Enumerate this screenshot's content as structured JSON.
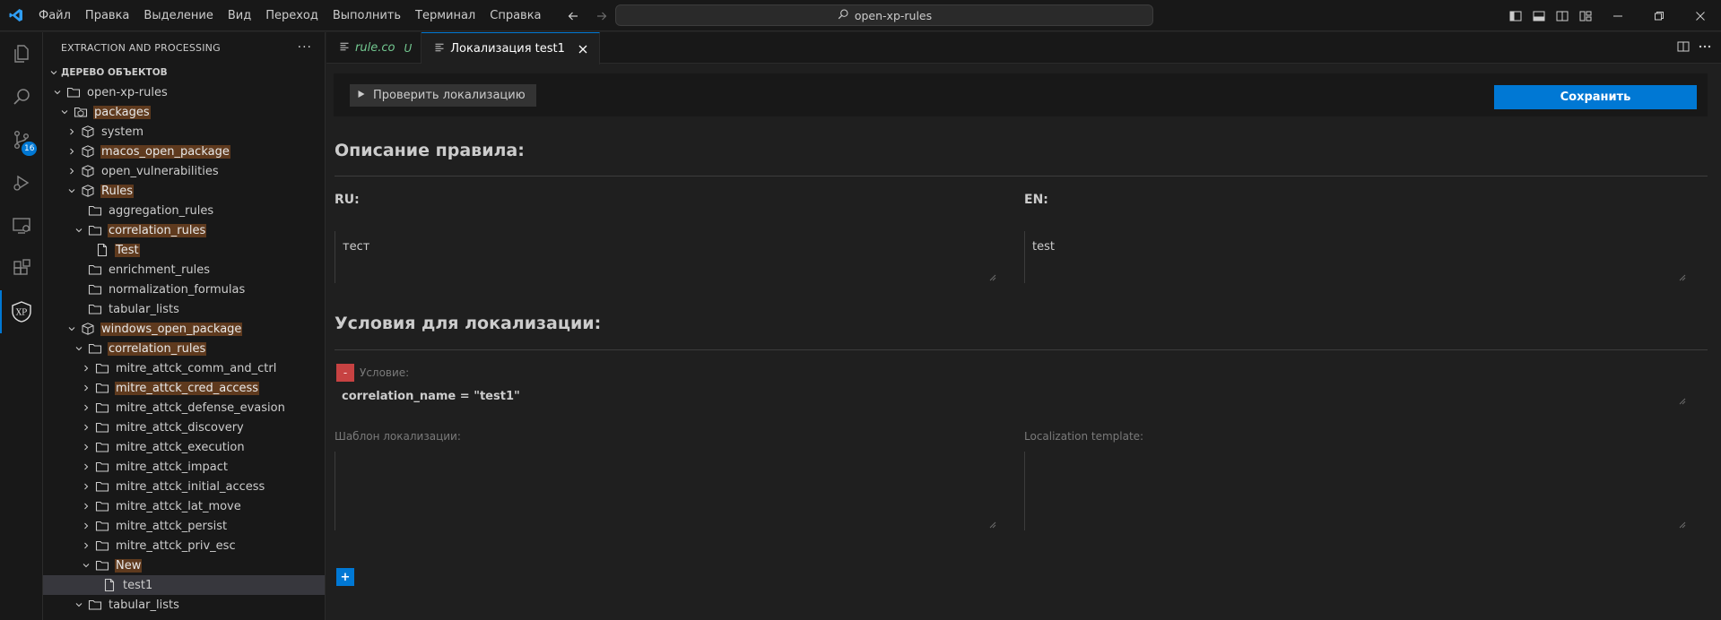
{
  "menu": [
    "Файл",
    "Правка",
    "Выделение",
    "Вид",
    "Переход",
    "Выполнить",
    "Терминал",
    "Справка"
  ],
  "search": {
    "text": "open-xp-rules"
  },
  "activity": {
    "scm_badge": "16",
    "xp_label": "XP"
  },
  "sidebar": {
    "title": "EXTRACTION AND PROCESSING",
    "more": "···",
    "section": "ДЕРЕВО ОБЪЕКТОВ",
    "tree": [
      {
        "label": "open-xp-rules",
        "depth": 0,
        "chevron": "down",
        "icon": "folder-icon",
        "hl": false
      },
      {
        "label": "packages",
        "depth": 1,
        "chevron": "down",
        "icon": "package-root-icon",
        "hl": true
      },
      {
        "label": "system",
        "depth": 2,
        "chevron": "right",
        "icon": "package-icon",
        "hl": false
      },
      {
        "label": "macos_open_package",
        "depth": 2,
        "chevron": "right",
        "icon": "package-icon",
        "hl": true
      },
      {
        "label": "open_vulnerabilities",
        "depth": 2,
        "chevron": "right",
        "icon": "package-icon",
        "hl": false
      },
      {
        "label": "Rules",
        "depth": 2,
        "chevron": "down",
        "icon": "package-icon",
        "hl": true
      },
      {
        "label": "aggregation_rules",
        "depth": 3,
        "chevron": "none",
        "icon": "folder-icon",
        "hl": false
      },
      {
        "label": "correlation_rules",
        "depth": 3,
        "chevron": "down",
        "icon": "folder-icon",
        "hl": true
      },
      {
        "label": "Test",
        "depth": 4,
        "chevron": "none",
        "icon": "file-icon",
        "hl": true
      },
      {
        "label": "enrichment_rules",
        "depth": 3,
        "chevron": "none",
        "icon": "folder-icon",
        "hl": false
      },
      {
        "label": "normalization_formulas",
        "depth": 3,
        "chevron": "none",
        "icon": "folder-icon",
        "hl": false
      },
      {
        "label": "tabular_lists",
        "depth": 3,
        "chevron": "none",
        "icon": "folder-icon",
        "hl": false
      },
      {
        "label": "windows_open_package",
        "depth": 2,
        "chevron": "down",
        "icon": "package-icon",
        "hl": true
      },
      {
        "label": "correlation_rules",
        "depth": 3,
        "chevron": "down",
        "icon": "folder-icon",
        "hl": true
      },
      {
        "label": "mitre_attck_comm_and_ctrl",
        "depth": 4,
        "chevron": "right",
        "icon": "folder-icon",
        "hl": false
      },
      {
        "label": "mitre_attck_cred_access",
        "depth": 4,
        "chevron": "right",
        "icon": "folder-icon",
        "hl": true
      },
      {
        "label": "mitre_attck_defense_evasion",
        "depth": 4,
        "chevron": "right",
        "icon": "folder-icon",
        "hl": false
      },
      {
        "label": "mitre_attck_discovery",
        "depth": 4,
        "chevron": "right",
        "icon": "folder-icon",
        "hl": false
      },
      {
        "label": "mitre_attck_execution",
        "depth": 4,
        "chevron": "right",
        "icon": "folder-icon",
        "hl": false
      },
      {
        "label": "mitre_attck_impact",
        "depth": 4,
        "chevron": "right",
        "icon": "folder-icon",
        "hl": false
      },
      {
        "label": "mitre_attck_initial_access",
        "depth": 4,
        "chevron": "right",
        "icon": "folder-icon",
        "hl": false
      },
      {
        "label": "mitre_attck_lat_move",
        "depth": 4,
        "chevron": "right",
        "icon": "folder-icon",
        "hl": false
      },
      {
        "label": "mitre_attck_persist",
        "depth": 4,
        "chevron": "right",
        "icon": "folder-icon",
        "hl": false
      },
      {
        "label": "mitre_attck_priv_esc",
        "depth": 4,
        "chevron": "right",
        "icon": "folder-icon",
        "hl": false
      },
      {
        "label": "New",
        "depth": 4,
        "chevron": "down",
        "icon": "folder-icon",
        "hl": true
      },
      {
        "label": "test1",
        "depth": 5,
        "chevron": "none",
        "icon": "file-icon",
        "hl": false,
        "selected": true
      },
      {
        "label": "tabular_lists",
        "depth": 3,
        "chevron": "down",
        "icon": "folder-icon",
        "hl": false
      }
    ]
  },
  "tabs": [
    {
      "label": "rule.co",
      "badge": "U",
      "active": false
    },
    {
      "label": "Локализация test1",
      "badge": "",
      "active": true
    }
  ],
  "editor": {
    "check_label": "Проверить локализацию",
    "save_label": "Сохранить",
    "description_title": "Описание правила:",
    "ru_label": "RU:",
    "en_label": "EN:",
    "ru_value": "тест",
    "en_value": "test",
    "conditions_title": "Условия для локализации:",
    "remove_label": "-",
    "condition_label": "Условие:",
    "condition_value": "correlation_name = \"test1\"",
    "template_ru_label": "Шаблон локализации:",
    "template_en_label": "Localization template:",
    "template_ru_value": "",
    "template_en_value": "",
    "add_label": "+"
  },
  "colors": {
    "accent": "#0078d4",
    "highlight": "#5f3a1e",
    "remove": "#c74242",
    "untracked": "#73c991"
  }
}
